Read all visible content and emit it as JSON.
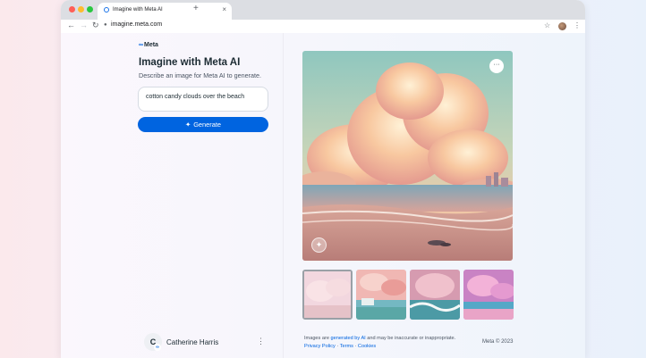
{
  "browser": {
    "tab_title": "Imagine with Meta AI",
    "tab_close": "×",
    "new_tab": "+",
    "url": "imagine.meta.com",
    "traffic_colors": [
      "#ff5f57",
      "#febc2e",
      "#28c840"
    ]
  },
  "brand": {
    "logo": "Meta"
  },
  "page": {
    "title": "Imagine with Meta AI",
    "subtitle": "Describe an image for Meta AI to generate.",
    "prompt_value": "cotton candy clouds over the beach",
    "generate_label": "Generate"
  },
  "user": {
    "initial": "C",
    "name": "Catherine Harris"
  },
  "footer": {
    "notice_prefix": "Images are",
    "notice_link": "generated by AI",
    "notice_suffix": "and may be inaccurate or inappropriate.",
    "privacy": "Privacy Policy",
    "terms": "Terms",
    "cookies": "Cookies",
    "sep": " · ",
    "copyright": "Meta © 2023"
  },
  "thumbnails_selected_index": 0,
  "colors": {
    "accent": "#0064e0",
    "text": "#1c2b33"
  }
}
